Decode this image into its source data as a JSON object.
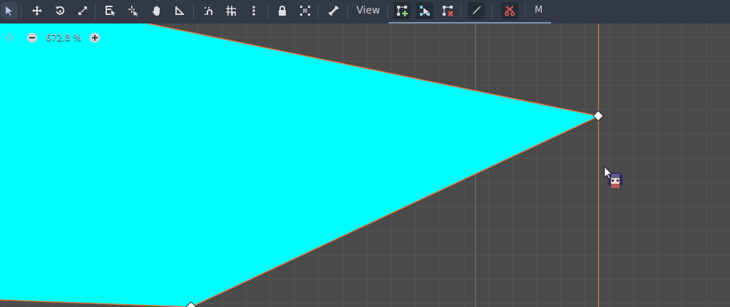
{
  "toolbar": {
    "view_label": "View",
    "m_label": "M",
    "tools": [
      {
        "name": "select-tool",
        "icon": "arrow-cursor-icon"
      },
      {
        "name": "move-tool",
        "icon": "move-arrows-icon"
      },
      {
        "name": "rotate-tool",
        "icon": "rotate-icon"
      },
      {
        "name": "scale-tool",
        "icon": "scale-icon"
      },
      {
        "name": "list-select-tool",
        "icon": "list-select-icon"
      },
      {
        "name": "pivot-tool",
        "icon": "pivot-icon"
      },
      {
        "name": "pan-tool",
        "icon": "hand-icon"
      },
      {
        "name": "ruler-tool",
        "icon": "ruler-icon"
      },
      {
        "name": "smart-snap-toggle",
        "icon": "smart-snap-icon"
      },
      {
        "name": "grid-snap-toggle",
        "icon": "grid-snap-icon"
      },
      {
        "name": "snap-options-menu",
        "icon": "vertical-dots-icon"
      },
      {
        "name": "lock-button",
        "icon": "lock-icon"
      },
      {
        "name": "group-button",
        "icon": "group-icon"
      },
      {
        "name": "bone-button",
        "icon": "bone-icon"
      },
      {
        "name": "create-points-tool",
        "icon": "create-points-icon"
      },
      {
        "name": "edit-points-tool",
        "icon": "edit-points-icon"
      },
      {
        "name": "delete-points-tool",
        "icon": "delete-points-icon"
      },
      {
        "name": "paint-tool",
        "icon": "pencil-icon"
      },
      {
        "name": "cut-tool",
        "icon": "scissors-icon"
      }
    ]
  },
  "viewport": {
    "zoom_label": "672.8 %",
    "zoom_out_icon": "minus-circle-icon",
    "zoom_in_icon": "plus-circle-icon",
    "zoom_reset_icon": "crosshair-icon",
    "polygon_fill": "#00ffff",
    "polygon_outline": "#e0753a",
    "guide_line": "#e0803a",
    "grid_color": "#555555",
    "grid_major_color": "#6a6a6a"
  },
  "colors": {
    "toolbar_bg": "#323844",
    "canvas_bg": "#4a4a4a",
    "accent": "#7f92b5"
  }
}
